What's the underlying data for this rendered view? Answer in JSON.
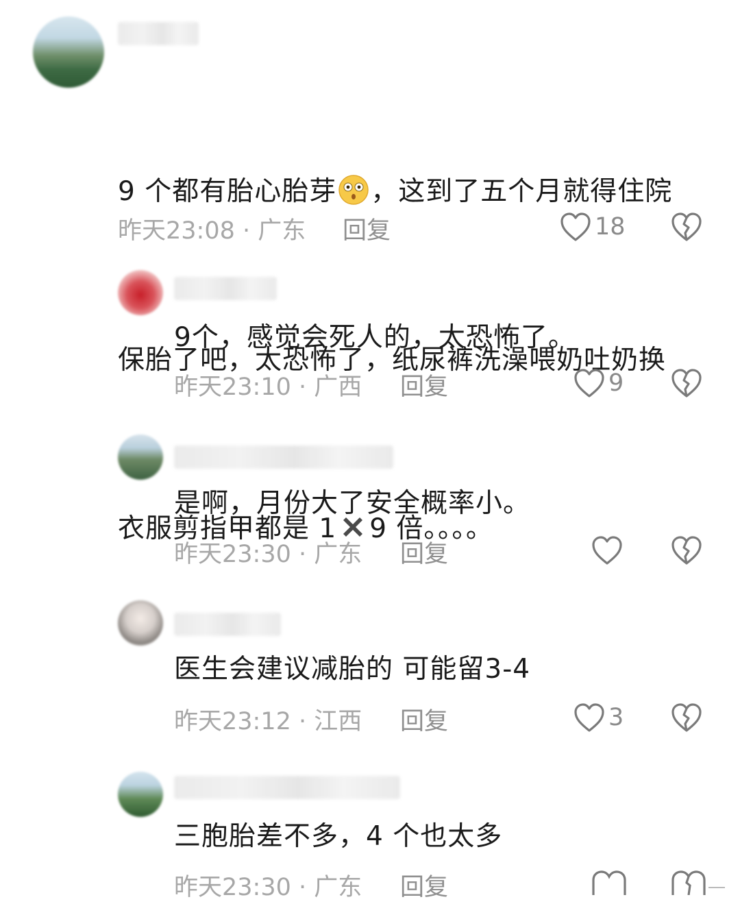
{
  "comments": [
    {
      "text_before_emoji": "9 个都有胎心胎芽",
      "emoji": "flushed-face-emoji",
      "text_after_emoji": "，这到了五个月就得住院",
      "line2": "保胎了吧，太恐怖了，纸尿裤洗澡喂奶吐奶换",
      "line3_before": "衣服剪指甲都是 1",
      "line3_icon": "cross-mark-icon",
      "line3_after": "9 倍。。。。",
      "time": "昨天23:08 · 广东",
      "reply": "回复",
      "likes": "18"
    },
    {
      "text": "9个，感觉会死人的，太恐怖了。",
      "time": "昨天23:10 · 广西",
      "reply": "回复",
      "likes": "9"
    },
    {
      "text": "是啊，月份大了安全概率小。",
      "time": "昨天23:30 · 广东",
      "reply": "回复",
      "likes": ""
    },
    {
      "text": "医生会建议减胎的 可能留3-4",
      "time": "昨天23:12 · 江西",
      "reply": "回复",
      "likes": "3"
    },
    {
      "text": "三胞胎差不多，4 个也太多",
      "time": "昨天23:30 · 广东",
      "reply": "回复",
      "likes": ""
    }
  ],
  "colors": {
    "text": "#1a1a1a",
    "meta": "#a7a7a7",
    "icon": "#7a7a7a"
  }
}
